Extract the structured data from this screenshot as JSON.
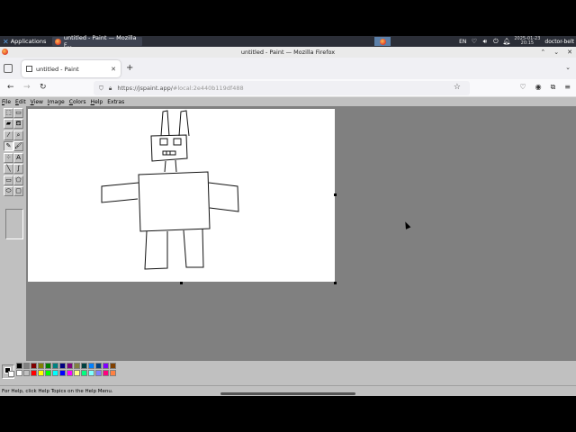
{
  "taskbar": {
    "applications_label": "Applications",
    "task_title": "untitled - Paint — Mozilla F...",
    "keyboard_layout": "EN",
    "clock_date": "2025-01-23",
    "clock_time": "20:15",
    "user": "doctor-belt"
  },
  "window": {
    "title": "untitled - Paint — Mozilla Firefox"
  },
  "browser": {
    "tab_title": "untitled - Paint",
    "url_main": "https://jspaint.app/",
    "url_hash": "#local:2e440b119df488"
  },
  "paint": {
    "menu": [
      {
        "hot": "F",
        "rest": "ile"
      },
      {
        "hot": "E",
        "rest": "dit"
      },
      {
        "hot": "V",
        "rest": "iew"
      },
      {
        "hot": "I",
        "rest": "mage"
      },
      {
        "hot": "C",
        "rest": "olors"
      },
      {
        "hot": "H",
        "rest": "elp"
      },
      {
        "hot": "",
        "rest": "Extras"
      }
    ],
    "status_text": "For Help, click Help Topics on the Help Menu.",
    "palette_top": [
      "#000000",
      "#808080",
      "#800000",
      "#808000",
      "#008000",
      "#008080",
      "#000080",
      "#800080",
      "#808040",
      "#004040",
      "#0080ff",
      "#004080",
      "#8000ff",
      "#804000"
    ],
    "palette_bottom": [
      "#ffffff",
      "#c0c0c0",
      "#ff0000",
      "#ffff00",
      "#00ff00",
      "#00ffff",
      "#0000ff",
      "#ff00ff",
      "#ffff80",
      "#00ff80",
      "#80ffff",
      "#8080ff",
      "#ff0080",
      "#ff8040"
    ]
  }
}
